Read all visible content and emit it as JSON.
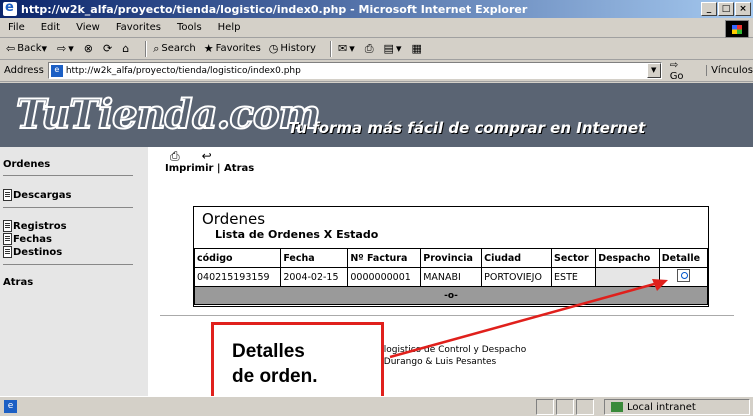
{
  "window": {
    "title": "http://w2k_alfa/proyecto/tienda/logistico/index0.php - Microsoft Internet Explorer"
  },
  "menu": [
    "File",
    "Edit",
    "View",
    "Favorites",
    "Tools",
    "Help"
  ],
  "toolbar": {
    "back": "Back",
    "search": "Search",
    "favorites": "Favorites",
    "history": "History"
  },
  "address": {
    "label": "Address",
    "url": "http://w2k_alfa/proyecto/tienda/logistico/index0.php",
    "go": "Go",
    "links": "Vínculos"
  },
  "site": {
    "logo": "TuTienda.com",
    "tagline": "Tu forma más fácil de comprar en Internet"
  },
  "sidebar": {
    "ordenes": "Ordenes",
    "descargas": "Descargas",
    "registros": "Registros",
    "fechas": "Fechas",
    "destinos": "Destinos",
    "atras": "Atras"
  },
  "actions": {
    "label": "Imprimir | Atras"
  },
  "panel": {
    "title": "Ordenes",
    "subtitle": "Lista de Ordenes X Estado",
    "columns": [
      "código",
      "Fecha",
      "Nº Factura",
      "Provincia",
      "Ciudad",
      "Sector",
      "Despacho",
      "Detalle"
    ],
    "rows": [
      [
        "040215193159",
        "2004-02-15",
        "0000000001",
        "MANABI",
        "PORTOVIEJO",
        "ESTE",
        "",
        ""
      ]
    ],
    "footer": "-o-"
  },
  "footer": {
    "line1": "dor logistico de Control y Despacho",
    "line2": "ner Durango & Luis Pesantes"
  },
  "callout": {
    "line1": "Detalles",
    "line2": "de orden."
  },
  "status": {
    "zone": "Local intranet"
  },
  "colors": {
    "callout_border": "#e0201c",
    "banner": "#5a6473"
  }
}
